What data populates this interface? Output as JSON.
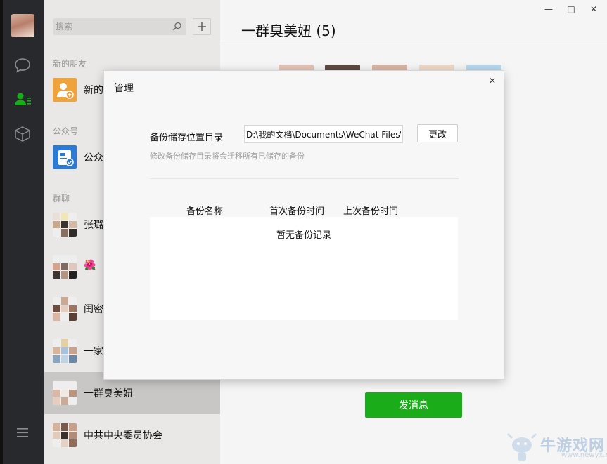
{
  "search": {
    "placeholder": "搜索"
  },
  "sections": {
    "new_friends": "新的朋友",
    "official": "公众号",
    "groups": "群聊"
  },
  "contacts": [
    {
      "label": "新的"
    },
    {
      "label": "公众"
    },
    {
      "label": "张璐"
    },
    {
      "label": "🌺"
    },
    {
      "label": "闺密"
    },
    {
      "label": "一家"
    },
    {
      "label": "一群臭美妞"
    },
    {
      "label": "中共中央委员协会"
    }
  ],
  "chat": {
    "title": "一群臭美妞 (5)",
    "send_label": "发消息"
  },
  "dialog": {
    "title": "管理",
    "dir_label": "备份储存位置目录",
    "dir_value": "D:\\我的文档\\Documents\\WeChat Files\\",
    "change_label": "更改",
    "hint": "修改备份储存目录将会迁移所有已储存的备份",
    "columns": [
      "备份名称",
      "首次备份时间",
      "上次备份时间"
    ],
    "empty_text": "暂无备份记录"
  },
  "watermark": {
    "text": "牛游戏网",
    "url": "www.newyx.net"
  },
  "colors": {
    "accent": "#1aad19",
    "sidebar": "#27292c",
    "list_bg": "#eae8e7"
  }
}
